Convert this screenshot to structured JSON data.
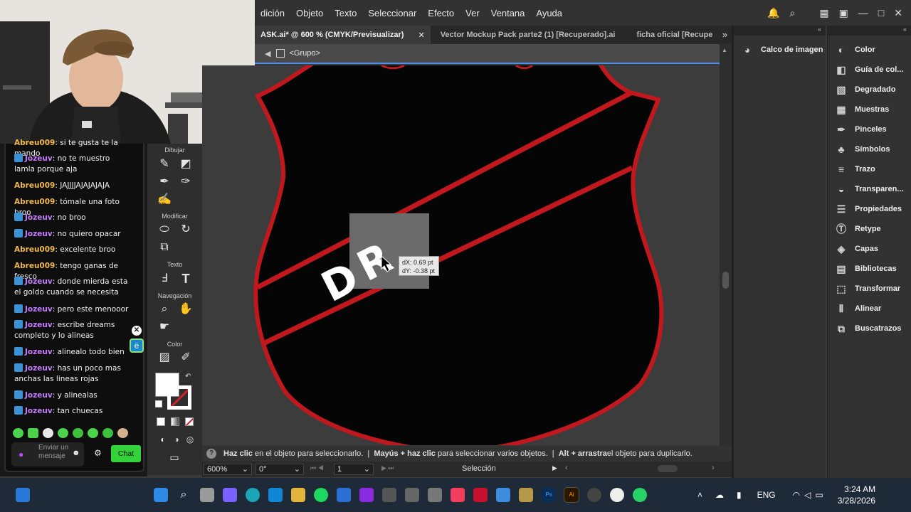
{
  "menu": {
    "items": [
      "dición",
      "Objeto",
      "Texto",
      "Seleccionar",
      "Efecto",
      "Ver",
      "Ventana",
      "Ayuda"
    ]
  },
  "tabs": [
    {
      "label": "ASK.ai* @ 600 % (CMYK/Previsualizar)",
      "active": true
    },
    {
      "label": "Vector Mockup Pack parte2  (1) [Recuperado].ai",
      "active": false
    },
    {
      "label": "ficha oficial [Recupe",
      "active": false
    }
  ],
  "breadcrumb": {
    "label": "<Grupo>"
  },
  "canvas": {
    "tooltip_dx": "dX: 0.69 pt",
    "tooltip_dy": "dY: -0.38 pt",
    "letters": [
      "D",
      "R"
    ],
    "colors": {
      "shield_fill": "#050505",
      "stripe": "#c0181d",
      "selection_box": "#6b6b6b"
    }
  },
  "toolbar": {
    "sections": [
      "Dibujar",
      "Modificar",
      "Texto",
      "Navegación",
      "Color"
    ]
  },
  "status": {
    "hint1_strong": "Haz clic",
    "hint1": " en el objeto para seleccionarlo.  |  ",
    "hint2_strong": "Mayús + haz clic",
    "hint2": " para seleccionar varios objetos.  |  ",
    "hint3_strong": "Alt + arrastra",
    "hint3": " el objeto para duplicarlo."
  },
  "bottom": {
    "zoom": "600%",
    "rotation": "0°",
    "artboard": "1",
    "tool": "Selección"
  },
  "panel_left": {
    "items": [
      "Calco de imagen"
    ]
  },
  "panel_right": {
    "items": [
      "Color",
      "Guía de col...",
      "Degradado",
      "Muestras",
      "Pinceles",
      "Símbolos",
      "Trazo",
      "Transparen...",
      "Propiedades",
      "Retype",
      "Capas",
      "Bibliotecas",
      "Transformar",
      "Alinear",
      "Buscatrazos"
    ],
    "icons": [
      "palette-icon",
      "color-guide-icon",
      "gradient-icon",
      "swatches-icon",
      "brush-icon",
      "symbols-icon",
      "stroke-icon",
      "transparency-icon",
      "properties-icon",
      "retype-icon",
      "layers-icon",
      "libraries-icon",
      "transform-icon",
      "align-icon",
      "pathfinder-icon"
    ]
  },
  "chat": {
    "messages": [
      {
        "user": "Abreu009",
        "text": ": si te gusta te la mando",
        "badge": false
      },
      {
        "user": "Jozeuv",
        "text": ": no te muestro lamla porque aja",
        "badge": true
      },
      {
        "user": "Abreu009",
        "text": ": JAJJJJAJAJAJAJA",
        "badge": false
      },
      {
        "user": "Abreu009",
        "text": ": tómale una foto broo",
        "badge": false
      },
      {
        "user": "Jozeuv",
        "text": ": no broo",
        "badge": true
      },
      {
        "user": "Jozeuv",
        "text": ": no quiero opacar",
        "badge": true
      },
      {
        "user": "Abreu009",
        "text": ": excelente broo",
        "badge": false
      },
      {
        "user": "Abreu009",
        "text": ": tengo ganas de fresco",
        "badge": false
      },
      {
        "user": "Jozeuv",
        "text": ": donde mierda esta el goldo cuando se necesita",
        "badge": true
      },
      {
        "user": "Jozeuv",
        "text": ": pero este menooor",
        "badge": true
      },
      {
        "user": "Jozeuv",
        "text": ": escribe dreams completo y lo alineas",
        "badge": true
      },
      {
        "user": "Jozeuv",
        "text": ": alinealo todo bien",
        "badge": true
      },
      {
        "user": "Jozeuv",
        "text": ": has un poco mas anchas las lineas rojas",
        "badge": true
      },
      {
        "user": "Jozeuv",
        "text": ": y alinealas",
        "badge": true
      },
      {
        "user": "Jozeuv",
        "text": ": tan chuecas",
        "badge": true
      }
    ],
    "input_placeholder": "Enviar un mensaje",
    "send_label": "Chat"
  },
  "taskbar": {
    "language": "ENG",
    "time": "3:24 AM",
    "date": "3/28/2026"
  }
}
